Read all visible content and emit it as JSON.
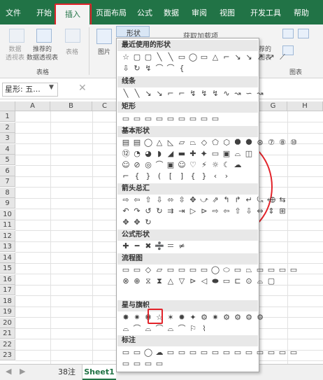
{
  "tabs": [
    "文件",
    "开始",
    "插入",
    "页面布局",
    "公式",
    "数据",
    "审阅",
    "视图",
    "开发工具",
    "帮助"
  ],
  "active_tab": "插入",
  "ribbon": {
    "pivot_label": "数据\n透视表",
    "rec_pivot_label": "推荐的\n数据透视表",
    "table_label": "表格",
    "group_tables": "表格",
    "picture_label": "图片",
    "shapes_label": "形状",
    "addins_label": "获取加载项",
    "rec_charts_label": "荐的\n图表",
    "group_charts": "图表"
  },
  "name_box": "星形: 五...",
  "columns": [
    "A",
    "B",
    "C",
    "G",
    "H"
  ],
  "rows": [
    "1",
    "2",
    "3",
    "4",
    "5",
    "6",
    "7",
    "8",
    "9",
    "10",
    "11",
    "12",
    "13",
    "14",
    "15",
    "16",
    "17",
    "18",
    "19",
    "20",
    "21",
    "22",
    "23"
  ],
  "sheets": [
    "38注",
    "Sheet1"
  ],
  "dropdown": {
    "sections": [
      "最近使用的形状",
      "线条",
      "矩形",
      "基本形状",
      "箭头总汇",
      "公式形状",
      "流程图",
      "星与旗帜",
      "标注"
    ],
    "recent_row1": [
      "☆",
      "▢",
      "▢",
      "╲",
      "╲",
      "▭",
      "◯",
      "▭",
      "△",
      "⌐",
      "↘",
      "↘",
      "↗",
      "↗",
      "⟋"
    ],
    "recent_row2": [
      "⇩",
      "↻",
      "↯",
      "⌒",
      "⌒",
      "{"
    ],
    "lines_row": [
      "╲",
      "╲",
      "↘",
      "↘",
      "⌐",
      "⌐",
      "↯",
      "↯",
      "↯",
      "∿",
      "↝",
      "∽",
      "↝"
    ],
    "rect_row": [
      "▭",
      "▭",
      "▭",
      "▭",
      "▭",
      "▭",
      "▭",
      "▭",
      "▭"
    ],
    "basic_rows": [
      [
        "▤",
        "▤",
        "◯",
        "△",
        "◺",
        "▱",
        "⏢",
        "◇",
        "⬠",
        "⬡",
        "⯃",
        "⯄",
        "⊛",
        "⑦",
        "⑧",
        "⑩"
      ],
      [
        "⑫",
        "◔",
        "◕",
        "◗",
        "◢",
        "▬",
        "✚",
        "⯌",
        "▭",
        "▣",
        "⌓",
        "◫"
      ],
      [
        "☺",
        "⊘",
        "◎",
        "⌒",
        "▣",
        "☺",
        "♡",
        "⚡",
        "☼",
        "☾",
        "☁"
      ],
      [
        "⌐",
        "{",
        "}",
        "(",
        "[",
        "]",
        "{",
        "}",
        "‹",
        "›"
      ]
    ],
    "arrow_rows": [
      [
        "⇨",
        "⇦",
        "⇧",
        "⇩",
        "⬄",
        "⇳",
        "✥",
        "⤻",
        "⇗",
        "↰",
        "↱",
        "↵",
        "⤿",
        "⬲",
        "⇆"
      ],
      [
        "↶",
        "↷",
        "↺",
        "↻",
        "⇉",
        "⇥",
        "▷",
        "⊳",
        "⇨",
        "⇦",
        "⇧",
        "⇩",
        "⇔",
        "⇕",
        "⊞"
      ],
      [
        "✥",
        "✥",
        "↻"
      ]
    ],
    "equation_row": [
      "✚",
      "━",
      "✖",
      "➗",
      "＝",
      "≠"
    ],
    "flow_rows": [
      [
        "▭",
        "▭",
        "◇",
        "▱",
        "▭",
        "▭",
        "▭",
        "▭",
        "◯",
        "⬭",
        "▭",
        "⏢",
        "▭",
        "▭",
        "▭",
        "▭"
      ],
      [
        "⊗",
        "⊕",
        "⧖",
        "⧗",
        "△",
        "▽",
        "⊳",
        "◁",
        "⬬",
        "▭",
        "⊏",
        "⊙",
        "⌓",
        "▢"
      ]
    ],
    "stars_rows": [
      [
        "✸",
        "✷",
        "✺",
        "☆",
        "✶",
        "✹",
        "✦",
        "⚙",
        "✷",
        "⚙",
        "⚙",
        "⚙",
        "⚙"
      ],
      [
        "⌓",
        "⌒",
        "⌓",
        "⌒",
        "⌓",
        "⌒",
        "⚐",
        "⌇"
      ]
    ],
    "callout_rows": [
      [
        "▭",
        "▭",
        "◯",
        "☁",
        "▭",
        "▭",
        "▭",
        "▭",
        "▭",
        "▭",
        "▭",
        "▭",
        "▭",
        "▭",
        "▭",
        "▭"
      ],
      [
        "▭",
        "▭",
        "▭",
        "▭"
      ]
    ]
  }
}
